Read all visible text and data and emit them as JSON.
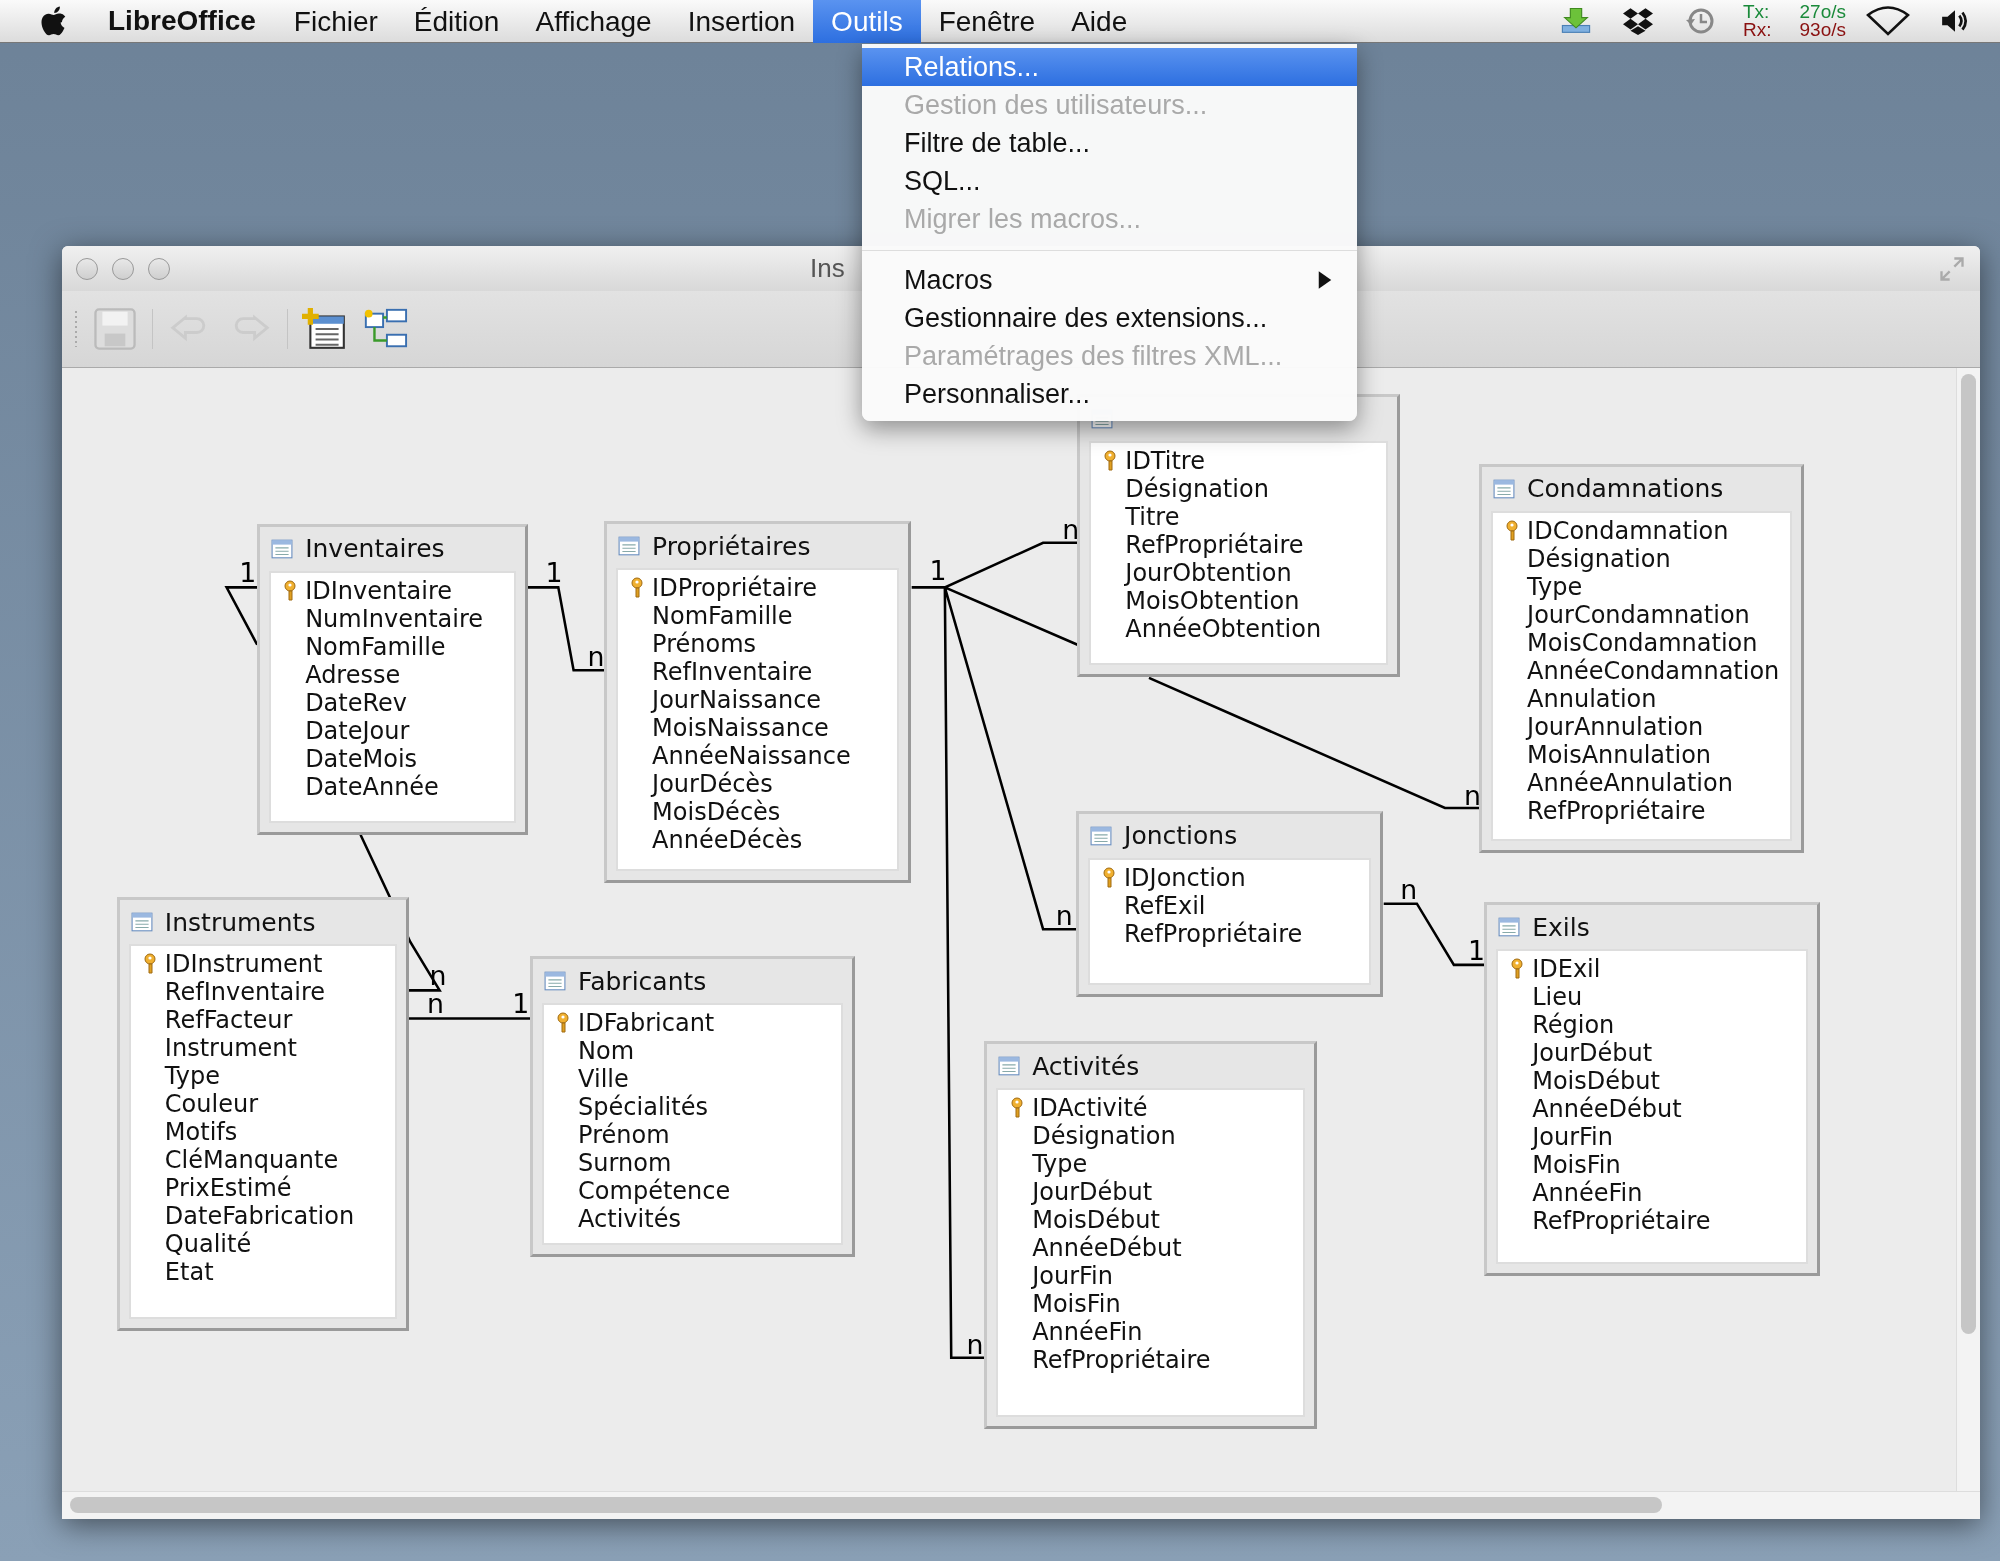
{
  "menu_bar": {
    "app_name": "LibreOffice",
    "items": [
      {
        "label": "Fichier",
        "selected": false
      },
      {
        "label": "Édition",
        "selected": false
      },
      {
        "label": "Affichage",
        "selected": false
      },
      {
        "label": "Insertion",
        "selected": false
      },
      {
        "label": "Outils",
        "selected": true
      },
      {
        "label": "Fenêtre",
        "selected": false
      },
      {
        "label": "Aide",
        "selected": false
      }
    ],
    "network": {
      "tx_label": "Tx:",
      "rx_label": "Rx:",
      "tx_rate": "27o/s",
      "rx_rate": "93o/s"
    }
  },
  "dropdown": [
    {
      "kind": "item",
      "label": "Relations...",
      "selected": true,
      "disabled": false
    },
    {
      "kind": "item",
      "label": "Gestion des utilisateurs...",
      "selected": false,
      "disabled": true
    },
    {
      "kind": "item",
      "label": "Filtre de table...",
      "selected": false,
      "disabled": false
    },
    {
      "kind": "item",
      "label": "SQL...",
      "selected": false,
      "disabled": false
    },
    {
      "kind": "item",
      "label": "Migrer les macros...",
      "selected": false,
      "disabled": true
    },
    {
      "kind": "separator"
    },
    {
      "kind": "submenu",
      "label": "Macros",
      "selected": false,
      "disabled": false
    },
    {
      "kind": "item",
      "label": "Gestionnaire des extensions...",
      "selected": false,
      "disabled": false
    },
    {
      "kind": "item",
      "label": "Paramétrages des filtres XML...",
      "selected": false,
      "disabled": true
    },
    {
      "kind": "item",
      "label": "Personnaliser...",
      "selected": false,
      "disabled": false
    }
  ],
  "window": {
    "title": "Ins"
  },
  "tables": [
    {
      "title": "Inventaires",
      "fields": [
        {
          "name": "IDInventaire",
          "key": true
        },
        {
          "name": "NumInventaire",
          "key": false
        },
        {
          "name": "NomFamille",
          "key": false
        },
        {
          "name": "Adresse",
          "key": false
        },
        {
          "name": "DateRev",
          "key": false
        },
        {
          "name": "DateJour",
          "key": false
        },
        {
          "name": "DateMois",
          "key": false
        },
        {
          "name": "DateAnnée",
          "key": false
        }
      ]
    },
    {
      "title": "Propriétaires",
      "fields": [
        {
          "name": "IDPropriétaire",
          "key": true
        },
        {
          "name": "NomFamille",
          "key": false
        },
        {
          "name": "Prénoms",
          "key": false
        },
        {
          "name": "RefInventaire",
          "key": false
        },
        {
          "name": "JourNaissance",
          "key": false
        },
        {
          "name": "MoisNaissance",
          "key": false
        },
        {
          "name": "AnnéeNaissance",
          "key": false
        },
        {
          "name": "JourDécès",
          "key": false
        },
        {
          "name": "MoisDécès",
          "key": false
        },
        {
          "name": "AnnéeDécès",
          "key": false
        }
      ]
    },
    {
      "fields": [
        {
          "name": "IDTitre",
          "key": true
        },
        {
          "name": "Désignation",
          "key": false
        },
        {
          "name": "Titre",
          "key": false
        },
        {
          "name": "RefPropriétaire",
          "key": false
        },
        {
          "name": "JourObtention",
          "key": false
        },
        {
          "name": "MoisObtention",
          "key": false
        },
        {
          "name": "AnnéeObtention",
          "key": false
        }
      ]
    },
    {
      "title": "Condamnations",
      "fields": [
        {
          "name": "IDCondamnation",
          "key": true
        },
        {
          "name": "Désignation",
          "key": false
        },
        {
          "name": "Type",
          "key": false
        },
        {
          "name": "JourCondamnation",
          "key": false
        },
        {
          "name": "MoisCondamnation",
          "key": false
        },
        {
          "name": "AnnéeCondamnation",
          "key": false
        },
        {
          "name": "Annulation",
          "key": false
        },
        {
          "name": "JourAnnulation",
          "key": false
        },
        {
          "name": "MoisAnnulation",
          "key": false
        },
        {
          "name": "AnnéeAnnulation",
          "key": false
        },
        {
          "name": "RefPropriétaire",
          "key": false
        }
      ]
    },
    {
      "title": "Instruments",
      "fields": [
        {
          "name": "IDInstrument",
          "key": true
        },
        {
          "name": "RefInventaire",
          "key": false
        },
        {
          "name": "RefFacteur",
          "key": false
        },
        {
          "name": "Instrument",
          "key": false
        },
        {
          "name": "Type",
          "key": false
        },
        {
          "name": "Couleur",
          "key": false
        },
        {
          "name": "Motifs",
          "key": false
        },
        {
          "name": "CléManquante",
          "key": false
        },
        {
          "name": "PrixEstimé",
          "key": false
        },
        {
          "name": "DateFabrication",
          "key": false
        },
        {
          "name": "Qualité",
          "key": false
        },
        {
          "name": "Etat",
          "key": false
        }
      ]
    },
    {
      "title": "Fabricants",
      "fields": [
        {
          "name": "IDFabricant",
          "key": true
        },
        {
          "name": "Nom",
          "key": false
        },
        {
          "name": "Ville",
          "key": false
        },
        {
          "name": "Spécialités",
          "key": false
        },
        {
          "name": "Prénom",
          "key": false
        },
        {
          "name": "Surnom",
          "key": false
        },
        {
          "name": "Compétence",
          "key": false
        },
        {
          "name": "Activités",
          "key": false
        }
      ]
    },
    {
      "title": "Activités",
      "fields": [
        {
          "name": "IDActivité",
          "key": true
        },
        {
          "name": "Désignation",
          "key": false
        },
        {
          "name": "Type",
          "key": false
        },
        {
          "name": "JourDébut",
          "key": false
        },
        {
          "name": "MoisDébut",
          "key": false
        },
        {
          "name": "AnnéeDébut",
          "key": false
        },
        {
          "name": "JourFin",
          "key": false
        },
        {
          "name": "MoisFin",
          "key": false
        },
        {
          "name": "AnnéeFin",
          "key": false
        },
        {
          "name": "RefPropriétaire",
          "key": false
        }
      ]
    },
    {
      "title": "Jonctions",
      "fields": [
        {
          "name": "IDJonction",
          "key": true
        },
        {
          "name": "RefExil",
          "key": false
        },
        {
          "name": "RefPropriétaire",
          "key": false
        }
      ]
    },
    {
      "title": "Exils",
      "fields": [
        {
          "name": "IDExil",
          "key": true
        },
        {
          "name": "Lieu",
          "key": false
        },
        {
          "name": "Région",
          "key": false
        },
        {
          "name": "JourDébut",
          "key": false
        },
        {
          "name": "MoisDébut",
          "key": false
        },
        {
          "name": "AnnéeDébut",
          "key": false
        },
        {
          "name": "JourFin",
          "key": false
        },
        {
          "name": "MoisFin",
          "key": false
        },
        {
          "name": "AnnéeFin",
          "key": false
        },
        {
          "name": "RefPropriétaire",
          "key": false
        }
      ]
    }
  ],
  "relations": [
    {
      "labels": [
        "1",
        "n"
      ]
    },
    {
      "labels": [
        "1",
        "n"
      ]
    },
    {
      "labels": [
        "1",
        "n",
        "n",
        "n",
        "n"
      ]
    },
    {
      "labels": [
        "n",
        "1"
      ]
    },
    {
      "labels": [
        "n",
        "1"
      ]
    }
  ]
}
